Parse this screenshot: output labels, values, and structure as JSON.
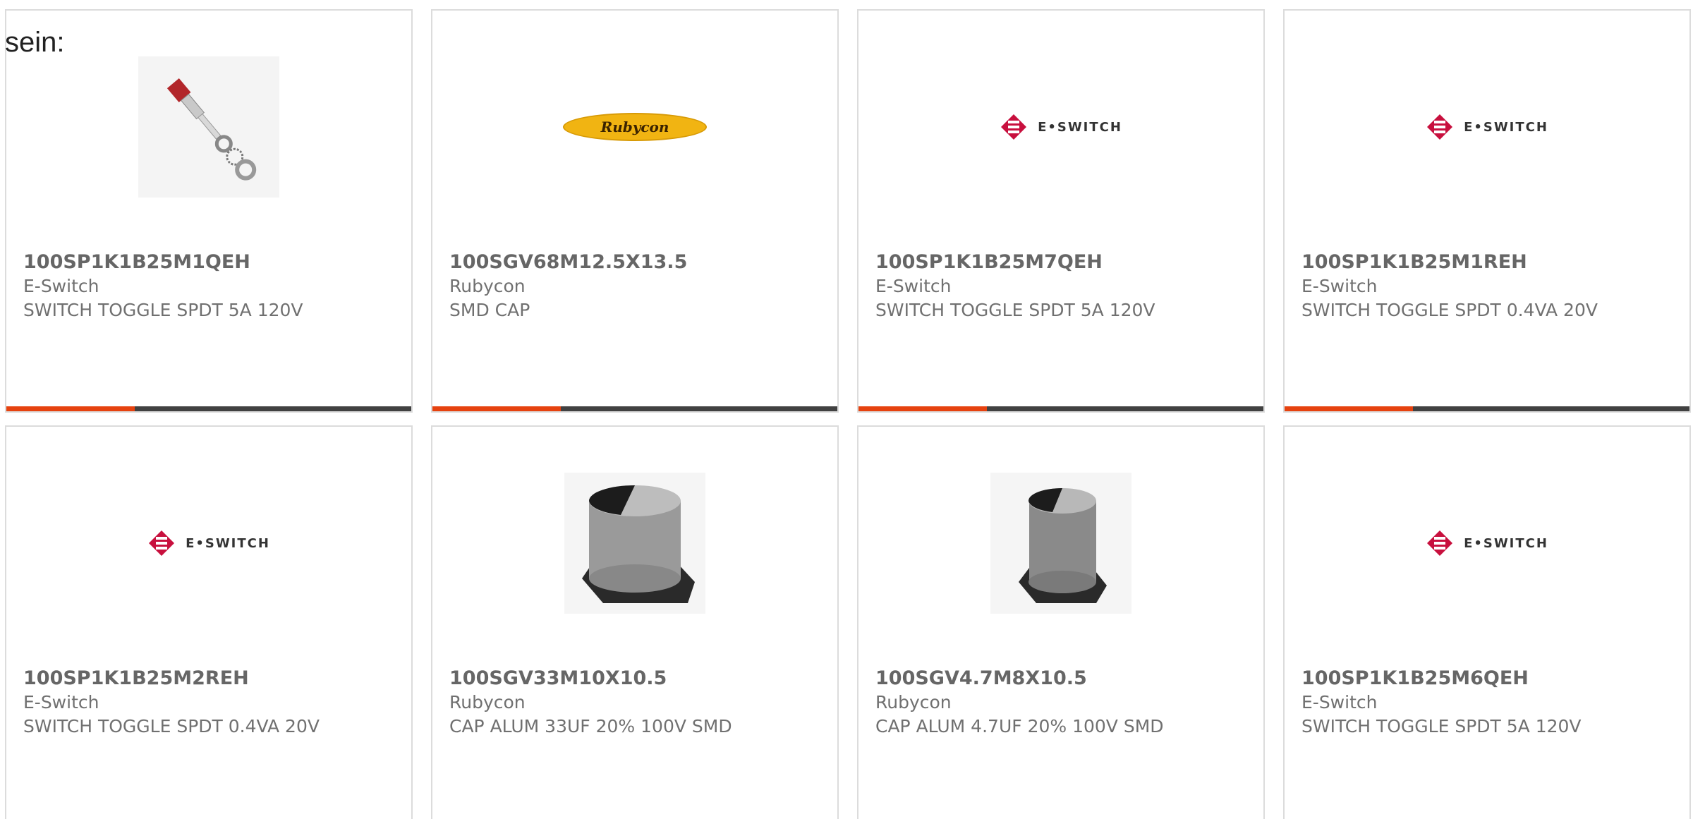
{
  "intro_text": "sein:",
  "accent_color": "#e6420f",
  "bar_color": "#414141",
  "products": [
    {
      "part_number": "100SP1K1B25M1QEH",
      "manufacturer": "E-Switch",
      "description": "SWITCH TOGGLE SPDT 5A 120V",
      "image": "toggle-switch-photo"
    },
    {
      "part_number": "100SGV68M12.5X13.5",
      "manufacturer": "Rubycon",
      "description": "SMD CAP",
      "image": "rubycon-logo",
      "logo_text": "Rubycon"
    },
    {
      "part_number": "100SP1K1B25M7QEH",
      "manufacturer": "E-Switch",
      "description": "SWITCH TOGGLE SPDT 5A 120V",
      "image": "eswitch-logo",
      "logo_text": "E•SWITCH"
    },
    {
      "part_number": "100SP1K1B25M1REH",
      "manufacturer": "E-Switch",
      "description": "SWITCH TOGGLE SPDT 0.4VA 20V",
      "image": "eswitch-logo",
      "logo_text": "E•SWITCH"
    },
    {
      "part_number": "100SP1K1B25M2REH",
      "manufacturer": "E-Switch",
      "description": "SWITCH TOGGLE SPDT 0.4VA 20V",
      "image": "eswitch-logo",
      "logo_text": "E•SWITCH"
    },
    {
      "part_number": "100SGV33M10X10.5",
      "manufacturer": "Rubycon",
      "description": "CAP ALUM 33UF 20% 100V SMD",
      "image": "smd-capacitor-photo"
    },
    {
      "part_number": "100SGV4.7M8X10.5",
      "manufacturer": "Rubycon",
      "description": "CAP ALUM 4.7UF 20% 100V SMD",
      "image": "smd-capacitor-photo"
    },
    {
      "part_number": "100SP1K1B25M6QEH",
      "manufacturer": "E-Switch",
      "description": "SWITCH TOGGLE SPDT 5A 120V",
      "image": "eswitch-logo",
      "logo_text": "E•SWITCH"
    }
  ]
}
